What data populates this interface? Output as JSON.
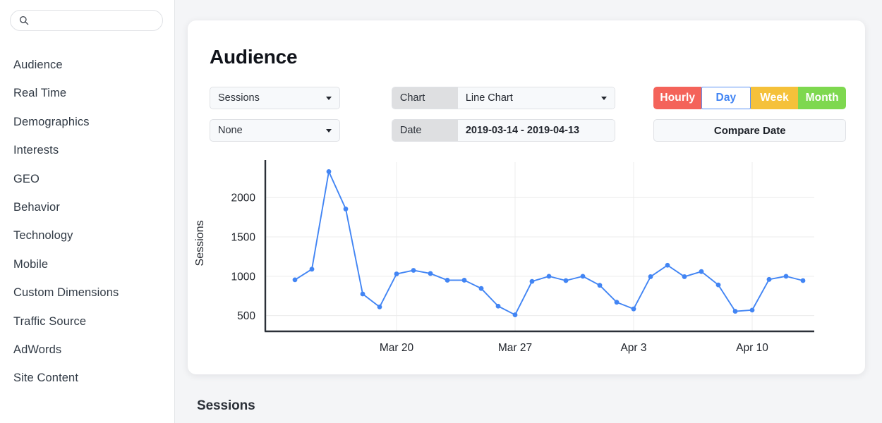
{
  "sidebar": {
    "search": {
      "placeholder": "",
      "value": "",
      "icon": "search-icon"
    },
    "items": [
      {
        "label": "Audience"
      },
      {
        "label": "Real Time"
      },
      {
        "label": "Demographics"
      },
      {
        "label": "Interests"
      },
      {
        "label": "GEO"
      },
      {
        "label": "Behavior"
      },
      {
        "label": "Technology"
      },
      {
        "label": "Mobile"
      },
      {
        "label": "Custom Dimensions"
      },
      {
        "label": "Traffic Source"
      },
      {
        "label": "AdWords"
      },
      {
        "label": "Site Content"
      }
    ]
  },
  "card": {
    "title": "Audience",
    "metric_select": {
      "value": "Sessions",
      "icon": "chevron-down-icon"
    },
    "secondary_select": {
      "value": "None",
      "icon": "chevron-down-icon"
    },
    "chart_group": {
      "label": "Chart",
      "value": "Line Chart",
      "icon": "chevron-down-icon"
    },
    "date_group": {
      "label": "Date",
      "value": "2019-03-14 - 2019-04-13"
    },
    "granularity": {
      "options": [
        {
          "label": "Hourly",
          "color": "#f4635a",
          "active": false
        },
        {
          "label": "Day",
          "color": "#ffffff",
          "active": true
        },
        {
          "label": "Week",
          "color": "#f5c13a",
          "active": false
        },
        {
          "label": "Month",
          "color": "#7ed84f",
          "active": false
        }
      ],
      "active_color": "#4285f4"
    },
    "compare_button": {
      "label": "Compare Date"
    }
  },
  "section_heading": "Sessions",
  "chart_data": {
    "type": "line",
    "title": "",
    "xlabel": "",
    "ylabel": "Sessions",
    "ylim": [
      300,
      2450
    ],
    "yticks": [
      500,
      1000,
      1500,
      2000
    ],
    "ytick_labels": [
      "500",
      "1000",
      "1500",
      "2000"
    ],
    "grid": true,
    "legend": false,
    "line_color": "#4285f4",
    "marker": "circle",
    "axis_color": "#2b3038",
    "xtick_labels": [
      "Mar 20",
      "Mar 27",
      "Apr 3",
      "Apr 10"
    ],
    "xtick_indices": [
      6,
      13,
      20,
      27
    ],
    "x": [
      "2019-03-14",
      "2019-03-15",
      "2019-03-16",
      "2019-03-17",
      "2019-03-18",
      "2019-03-19",
      "2019-03-20",
      "2019-03-21",
      "2019-03-22",
      "2019-03-23",
      "2019-03-24",
      "2019-03-25",
      "2019-03-26",
      "2019-03-27",
      "2019-03-28",
      "2019-03-29",
      "2019-03-30",
      "2019-03-31",
      "2019-04-01",
      "2019-04-02",
      "2019-04-03",
      "2019-04-04",
      "2019-04-05",
      "2019-04-06",
      "2019-04-07",
      "2019-04-08",
      "2019-04-09",
      "2019-04-10",
      "2019-04-11",
      "2019-04-12",
      "2019-04-13"
    ],
    "series": [
      {
        "name": "Sessions",
        "values": [
          955,
          1090,
          2330,
          1855,
          775,
          610,
          1030,
          1075,
          1035,
          950,
          950,
          845,
          620,
          510,
          935,
          1000,
          945,
          1000,
          885,
          670,
          585,
          995,
          1140,
          995,
          1060,
          890,
          555,
          570,
          960,
          1000,
          945
        ]
      }
    ]
  }
}
